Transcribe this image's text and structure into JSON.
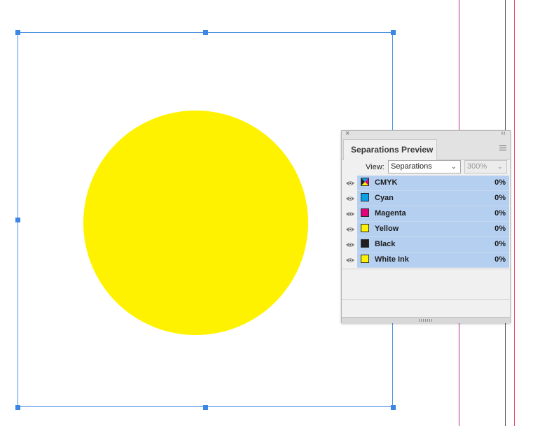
{
  "canvas": {
    "ellipse_fill": "#FFF200",
    "selection_color": "#3B86E6"
  },
  "panel": {
    "title": "Separations Preview",
    "close_glyph": "×",
    "collapse_glyph": "‹‹",
    "view_label": "View:",
    "view_value": "Separations",
    "zoom_value": "300%",
    "separations": [
      {
        "name": "CMYK",
        "percent": "0%",
        "swatch": "cmyk",
        "icon": "eye-icon"
      },
      {
        "name": "Cyan",
        "percent": "0%",
        "swatch": "#0AA0E6",
        "icon": "eye-icon"
      },
      {
        "name": "Magenta",
        "percent": "0%",
        "swatch": "#E0007A",
        "icon": "eye-icon"
      },
      {
        "name": "Yellow",
        "percent": "0%",
        "swatch": "#FFF200",
        "icon": "eye-icon"
      },
      {
        "name": "Black",
        "percent": "0%",
        "swatch": "#231F20",
        "icon": "eye-icon"
      },
      {
        "name": "White Ink",
        "percent": "0%",
        "swatch": "#FFF200",
        "icon": "eye-icon"
      }
    ]
  }
}
